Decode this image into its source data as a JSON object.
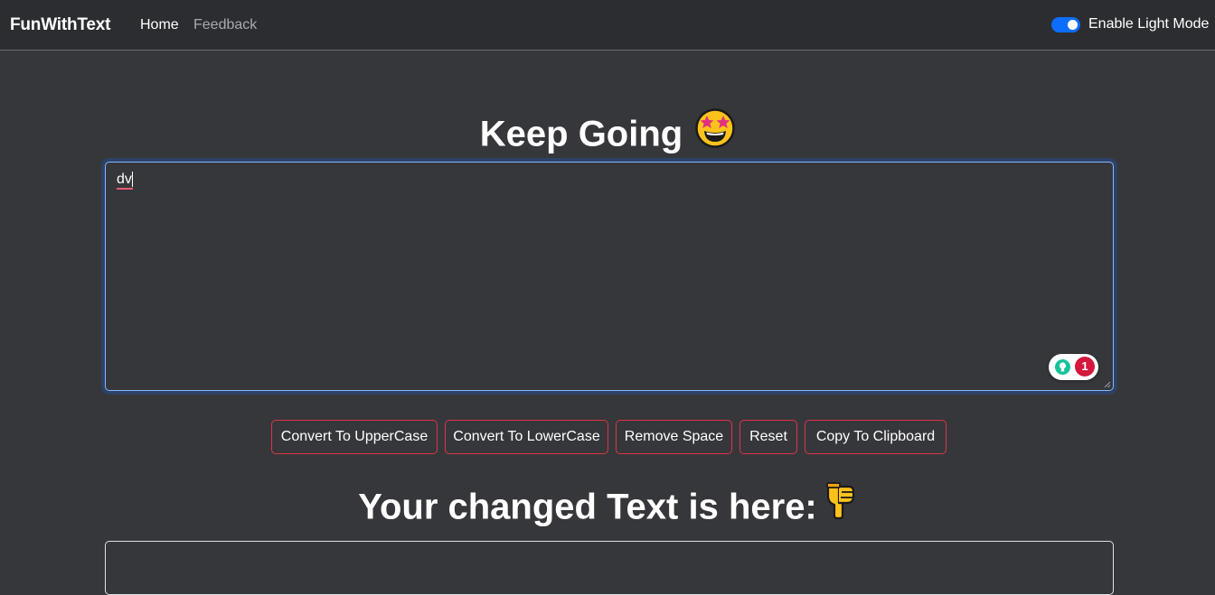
{
  "navbar": {
    "brand": "FunWithText",
    "links": [
      {
        "label": "Home"
      },
      {
        "label": "Feedback"
      }
    ],
    "mode_toggle_label": "Enable Light Mode"
  },
  "main": {
    "heading": "Keep Going",
    "heading_emoji_icon": "star-struck-emoji-icon",
    "textarea_value": "dv",
    "grammar_issue_count": "1",
    "buttons": [
      {
        "label": "Convert To UpperCase"
      },
      {
        "label": "Convert To LowerCase"
      },
      {
        "label": "Remove Space"
      },
      {
        "label": "Reset"
      },
      {
        "label": "Copy To Clipboard"
      }
    ],
    "result_heading": "Your changed Text is here:",
    "result_emoji_icon": "pointing-down-emoji-icon"
  },
  "colors": {
    "background": "#36373b",
    "navbar": "#2b2d31",
    "accent": "#0d6efd",
    "button_border": "#dc3545",
    "grammar_green": "#15c39a",
    "grammar_red": "#d4183d"
  }
}
